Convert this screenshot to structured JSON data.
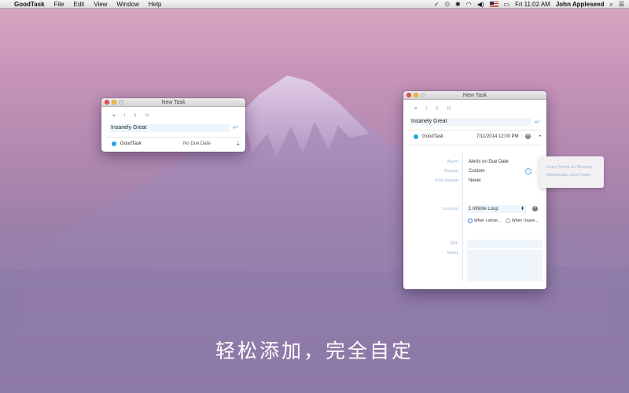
{
  "menubar": {
    "app_name": "GoodTask",
    "items": [
      "File",
      "Edit",
      "View",
      "Window",
      "Help"
    ],
    "status": {
      "checkmark": "✓",
      "clock": "⏲",
      "bluetooth": "✱",
      "wifi": "◠",
      "volume": "◀)",
      "flag": "us-flag",
      "battery": "▭",
      "datetime": "Fri 11:02 AM",
      "user": "John Appleseed",
      "search": "⌕",
      "list": "☰"
    }
  },
  "small_window": {
    "title": "New Task",
    "priority": [
      "×",
      "!",
      "!!",
      "!!!"
    ],
    "task_name": "Insanely Great",
    "list_name": "GoodTask",
    "due": "No Due Date",
    "return_glyph": "↵",
    "expand_glyph": "⇣"
  },
  "large_window": {
    "title": "New Task",
    "priority": [
      "×",
      "!",
      "!!",
      "!!!"
    ],
    "task_name": "Insanely Great",
    "list_name": "GoodTask",
    "due": "7/11/2014 12:00 PM",
    "return_glyph": "↵",
    "clear_glyph": "×",
    "collapse_glyph": "⌃",
    "alarm_label": "Alarm",
    "alarm_value": "Alerts on Due Date",
    "repeat_label": "Repeat",
    "repeat_value": "Custom",
    "info_glyph": "i",
    "end_repeat_label": "End Repeat",
    "end_repeat_value": "Never",
    "location_label": "Location",
    "location_value": "1 Infinite Loop",
    "location_stepper": "⬍",
    "location_clear": "×",
    "arrive_label": "When I arrive...",
    "leave_label": "When I leave...",
    "url_label": "URL",
    "notes_label": "Notes"
  },
  "tooltip": {
    "line1": "Every Week on Monday,",
    "line2": "Wednesday and Friday"
  },
  "caption": "轻松添加，完全自定",
  "colors": {
    "accent": "#1ea6e0",
    "label": "#9ab8d6",
    "input_bg": "#eef6fb"
  }
}
